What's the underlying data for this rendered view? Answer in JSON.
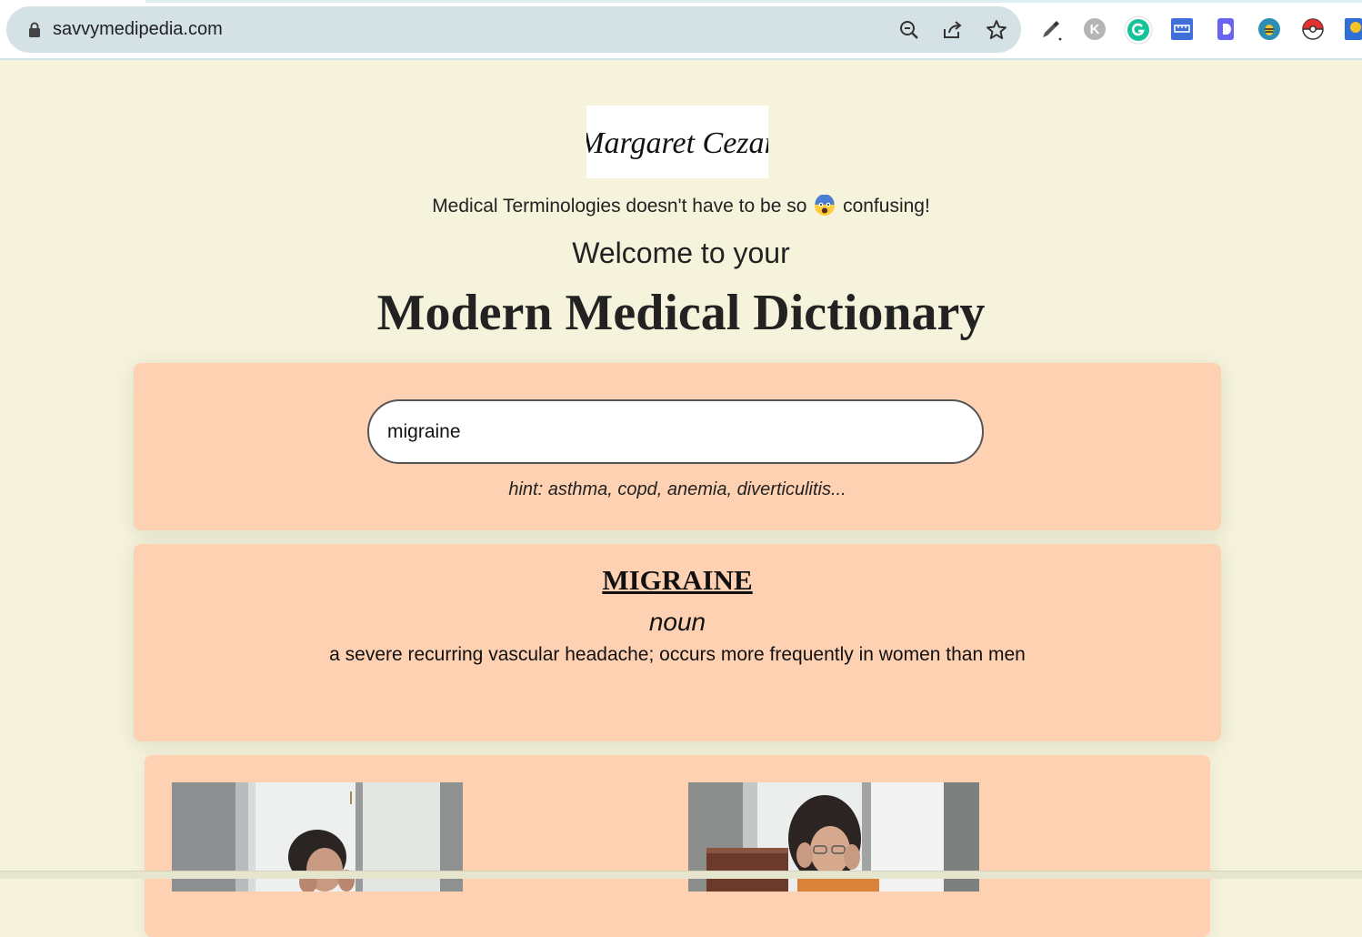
{
  "browser": {
    "url": "savvymedipedia.com"
  },
  "page": {
    "logo_text": "Margaret Cezar",
    "tagline_before": "Medical Terminologies doesn't have to be so",
    "tagline_after": "confusing!",
    "welcome": "Welcome to your",
    "title": "Modern Medical Dictionary"
  },
  "search": {
    "value": "migraine",
    "hint": "hint: asthma, copd, anemia, diverticulitis..."
  },
  "result": {
    "word": "MIGRAINE",
    "part_of_speech": "noun",
    "definition": "a severe recurring vascular headache; occurs more frequently in women than men"
  },
  "colors": {
    "page_bg": "#f5f3dc",
    "card_bg": "#ffd1b3"
  }
}
